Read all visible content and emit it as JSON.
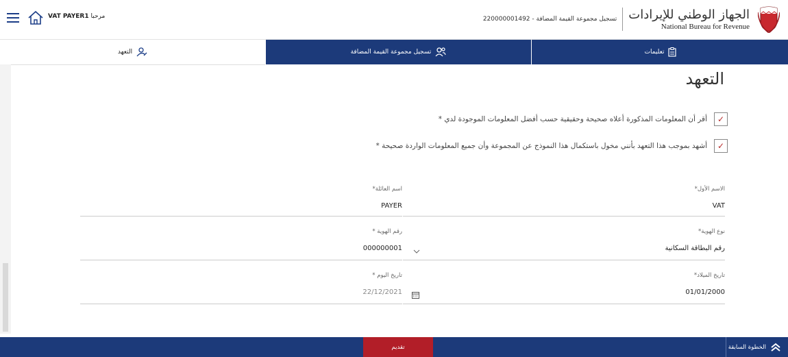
{
  "header": {
    "welcome_prefix": "مرحبا",
    "user_name": "VAT PAYER1",
    "registration_title": "تسجيل مجموعة القيمة المضافة - 220000001492",
    "logo_arabic": "الجهاز الوطني للإيرادات",
    "logo_english": "National Bureau for Revenue"
  },
  "tabs": [
    {
      "label": "التعهد",
      "icon": "person-edit-icon"
    },
    {
      "label": "تسجيل مجموعة القيمة المضافة",
      "icon": "group-icon"
    },
    {
      "label": "تعليمات",
      "icon": "clipboard-icon"
    }
  ],
  "page_title": "التعهد",
  "declarations": [
    {
      "text": "أقر أن المعلومات المذكورة أعلاه صحيحة وحقيقية حسب أفضل المعلومات الموجودة لدي *",
      "checked": true
    },
    {
      "text": "أشهد بموجب هذا التعهد بأنني مخول باستكمال هذا النموذج عن المجموعة وأن جميع المعلومات الواردة صحيحة *",
      "checked": true
    }
  ],
  "form": {
    "first_name": {
      "label": "الاسم الأول*",
      "value": "VAT"
    },
    "family_name": {
      "label": "اسم العائلة*",
      "value": "PAYER"
    },
    "id_type": {
      "label": "نوع الهوية*",
      "value": "رقم البطاقة السكانية"
    },
    "id_number": {
      "label": "رقم الهوية *",
      "value": "000000001"
    },
    "birth_date": {
      "label": "تاريخ الميلاد*",
      "value": "01/01/2000"
    },
    "today_date": {
      "label": "تاريخ اليوم *",
      "value": "22/12/2021"
    }
  },
  "footer": {
    "submit_label": "تقديم",
    "previous_label": "الخطوة السابقة"
  },
  "colors": {
    "navy": "#1c3a7a",
    "submit_red": "#b21e28",
    "check_red": "#b82a2a"
  }
}
